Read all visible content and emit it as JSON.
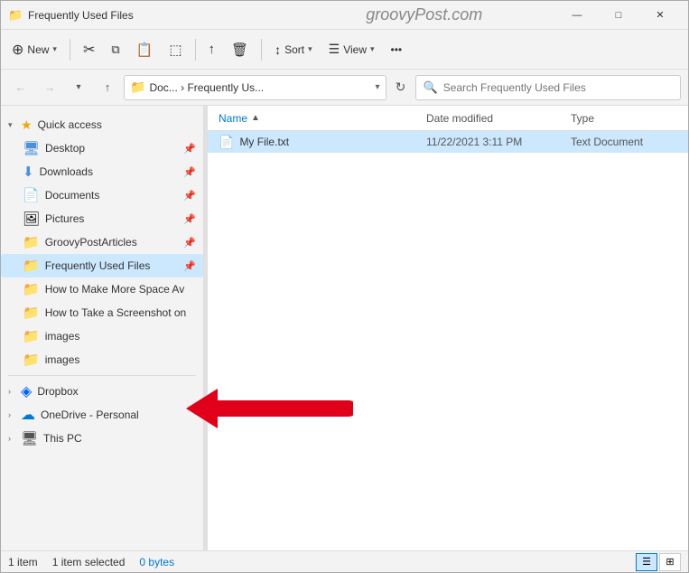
{
  "window": {
    "title": "Frequently Used Files",
    "watermark": "groovyPost.com"
  },
  "titlebar": {
    "minimize": "—",
    "maximize": "□",
    "close": "✕"
  },
  "toolbar": {
    "new_label": "New",
    "sort_label": "Sort",
    "view_label": "View",
    "buttons": [
      {
        "id": "cut",
        "icon": "✂",
        "label": ""
      },
      {
        "id": "copy",
        "icon": "⧉",
        "label": ""
      },
      {
        "id": "paste",
        "icon": "📋",
        "label": ""
      },
      {
        "id": "rename",
        "icon": "⬚",
        "label": ""
      },
      {
        "id": "share",
        "icon": "↑",
        "label": ""
      },
      {
        "id": "delete",
        "icon": "🗑",
        "label": ""
      }
    ]
  },
  "addressbar": {
    "path_short": "Doc...  ›  Frequently Us...",
    "search_placeholder": "Search Frequently Used Files"
  },
  "sidebar": {
    "quick_access_label": "Quick access",
    "items": [
      {
        "id": "desktop",
        "label": "Desktop",
        "icon": "🖥",
        "pinned": true
      },
      {
        "id": "downloads",
        "label": "Downloads",
        "icon": "⬇",
        "pinned": true
      },
      {
        "id": "documents",
        "label": "Documents",
        "icon": "📄",
        "pinned": true
      },
      {
        "id": "pictures",
        "label": "Pictures",
        "icon": "🖼",
        "pinned": true
      },
      {
        "id": "groovypostarticles",
        "label": "GroovyPostArticles",
        "icon": "📁",
        "pinned": true
      },
      {
        "id": "frequently-used",
        "label": "Frequently Used Files",
        "icon": "📁",
        "pinned": true,
        "active": true
      },
      {
        "id": "how-to-make",
        "label": "How to Make More Space Av",
        "icon": "📁",
        "pinned": false
      },
      {
        "id": "how-to-take",
        "label": "How to Take a Screenshot on",
        "icon": "📁",
        "pinned": false
      },
      {
        "id": "images1",
        "label": "images",
        "icon": "📁",
        "pinned": false
      },
      {
        "id": "images2",
        "label": "images",
        "icon": "📁",
        "pinned": false
      }
    ],
    "sections": [
      {
        "id": "dropbox",
        "label": "Dropbox",
        "icon": "📦"
      },
      {
        "id": "onedrive",
        "label": "OneDrive - Personal",
        "icon": "☁"
      },
      {
        "id": "thispc",
        "label": "This PC",
        "icon": "💻"
      }
    ]
  },
  "filelist": {
    "columns": {
      "name": "Name",
      "date_modified": "Date modified",
      "type": "Type"
    },
    "files": [
      {
        "name": "My File.txt",
        "icon": "📄",
        "date_modified": "11/22/2021 3:11 PM",
        "type": "Text Document",
        "selected": true
      }
    ]
  },
  "statusbar": {
    "item_count": "1 item",
    "selected_text": "1 item selected",
    "size": "0 bytes"
  }
}
